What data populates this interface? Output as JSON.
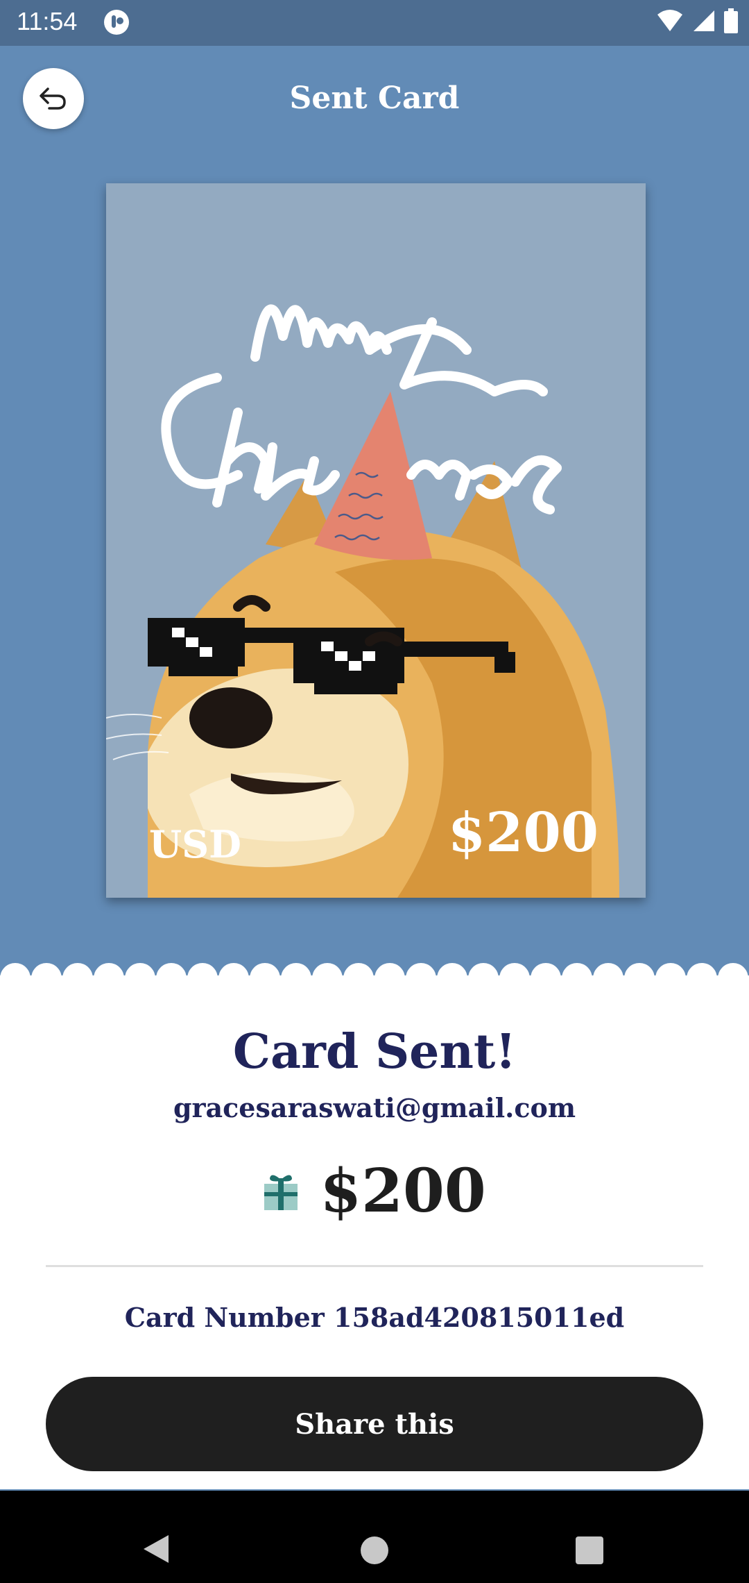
{
  "status_bar": {
    "time": "11:54"
  },
  "header": {
    "title": "Sent Card"
  },
  "card": {
    "greeting": "Merry Christmas",
    "currency": "USD",
    "amount": "$200"
  },
  "confirmation": {
    "title": "Card Sent!",
    "recipient_email": "gracesaraswati@gmail.com",
    "amount": "$200",
    "card_number_text": "Card Number 158ad420815011ed"
  },
  "actions": {
    "share_label": "Share this"
  },
  "icons": {
    "back": "undo-arrow-icon",
    "gift": "gift-icon",
    "wifi": "wifi-icon",
    "signal": "cell-signal-icon",
    "battery": "battery-icon"
  },
  "colors": {
    "background": "#628bb6",
    "status_bar": "#4d6d91",
    "card_bg": "#93aac1",
    "text_dark": "#20245a",
    "button": "#1f1f1f"
  }
}
